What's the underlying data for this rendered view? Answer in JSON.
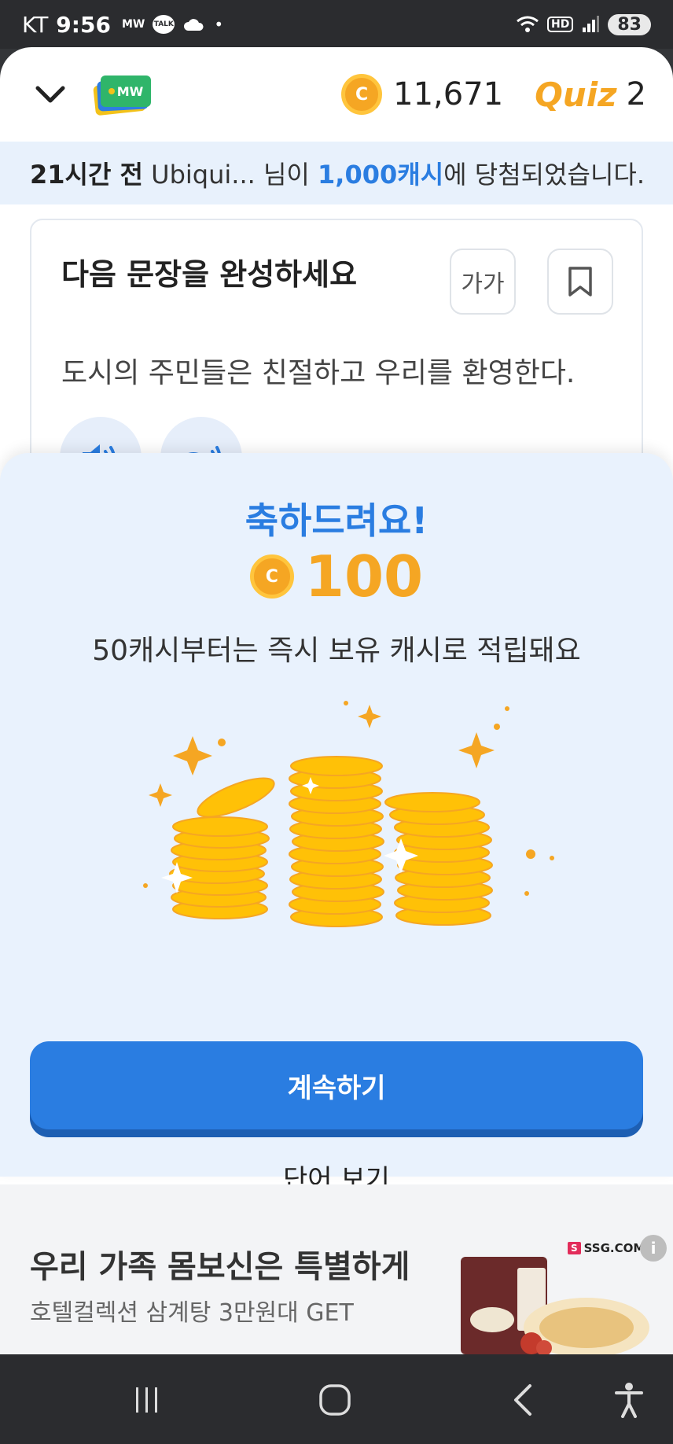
{
  "status_bar": {
    "carrier": "KT",
    "time": "9:56",
    "mw": "MW",
    "talk": "TALK",
    "network": "5",
    "hd": "HD",
    "battery": "83"
  },
  "header": {
    "cash_amount": "11,671",
    "coin_symbol": "C",
    "quiz_label": "Quiz",
    "quiz_count": "2",
    "logo_text": "MW"
  },
  "banner": {
    "time_ago": "21시간 전",
    "user": " Ubiqui... 님이 ",
    "prize": "1,000캐시",
    "suffix": "에 당첨되었습니다."
  },
  "quiz_card": {
    "title": "다음 문장을 완성하세요",
    "font_button_label": "가가",
    "sentence": "도시의 주민들은 친절하고 우리를 환영한다."
  },
  "reward_sheet": {
    "congrats": "축하드려요!",
    "amount": "100",
    "subtitle": "50캐시부터는 즉시 보유 캐시로 적립돼요",
    "continue_label": "계속하기",
    "view_words_label": "단어 보기"
  },
  "ad": {
    "title": "우리 가족 몸보신은 특별하게",
    "description": "호텔컬렉션 삼계탕 3만원대 GET",
    "brand": "SSG.COM",
    "brand_mark": "S",
    "info": "i"
  },
  "colors": {
    "accent": "#2a7de1",
    "coin": "#f5a623",
    "sheet_bg": "#e9f2fd"
  }
}
